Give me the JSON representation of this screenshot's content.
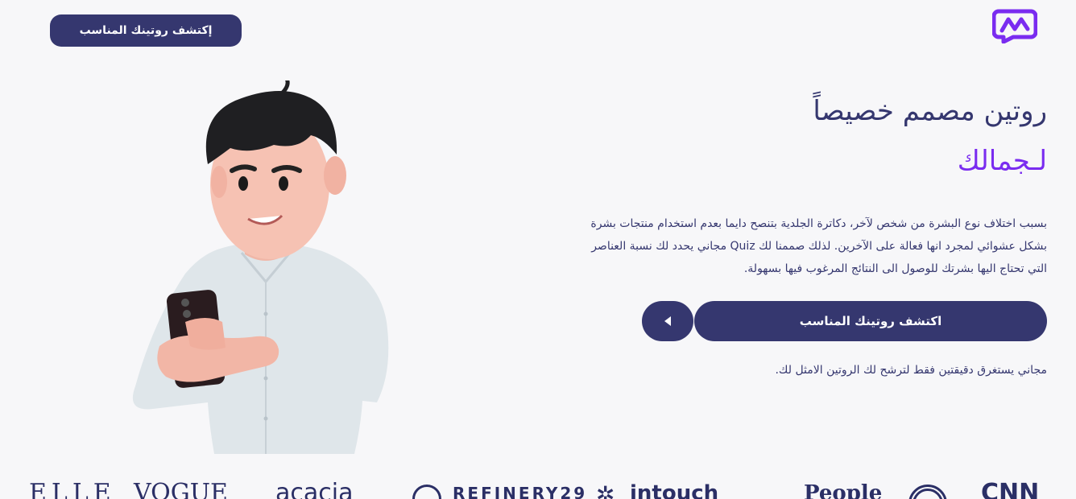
{
  "header": {
    "cta_label": "إكتشف روتينك المناسب",
    "logo_icon": "brand-logo-icon"
  },
  "hero": {
    "title": "روتين مصمم خصيصاً",
    "accent": "لـجمالك",
    "body_lines": [
      "بسبب اختلاف نوع البشرة من شخص لآخر، دكاترة الجلدية بتنصح دايما بعدم استخدام منتجات بشرة",
      "بشكل عشوائي لمجرد انها فعالة على الآخرين. لذلك صممنا لك Quiz مجاني يحدد لك نسبة العناصر",
      "التي تحتاج اليها بشرتك للوصول الى النتائج المرغوب فيها بسهولة."
    ],
    "cta_label": "اكتشف روتينك المناسب",
    "arrow_icon": "play-arrow-icon",
    "hint": "مجاني يستغرق دقيقتين فقط لترشح لك الروتين الامثل لك."
  },
  "brands": [
    "ELLE",
    "VOGUE",
    "acacia",
    "REFINERY29",
    "intouch",
    "People",
    "CNN"
  ],
  "colors": {
    "primary": "#35376f",
    "accent": "#7a2cf0",
    "background": "#f7f7f9"
  }
}
